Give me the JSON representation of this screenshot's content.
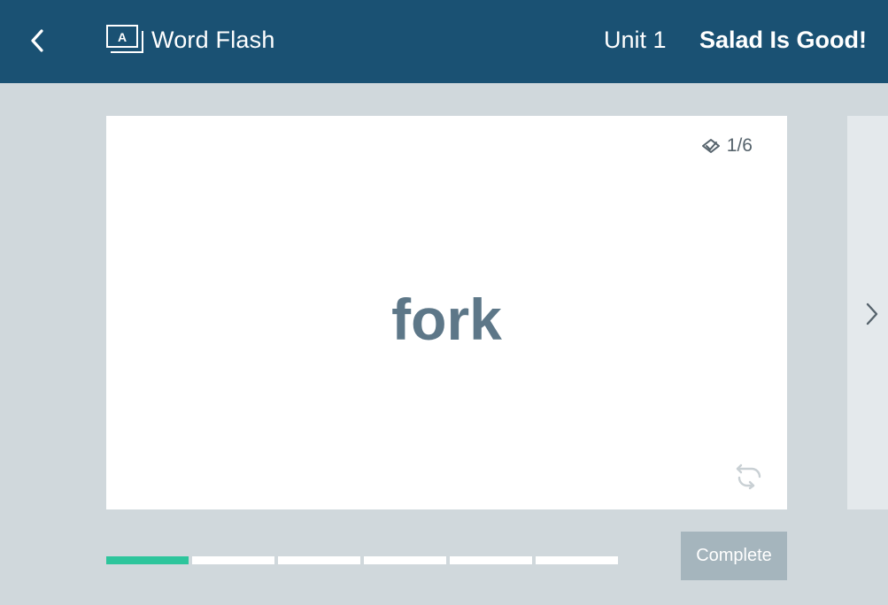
{
  "header": {
    "back_icon": "chevron-left-icon",
    "app_icon": "flashcard-icon",
    "app_icon_letter": "A",
    "app_title": "Word Flash",
    "unit": "Unit 1",
    "lesson_title": "Salad Is Good!"
  },
  "card": {
    "word": "fork",
    "counter_icon": "double-check-icon",
    "counter": "1/6",
    "flip_icon": "flip-arrows-icon"
  },
  "next_icon": "chevron-right-icon",
  "progress": {
    "current": 1,
    "total": 6,
    "done_color": "#2dc59c",
    "todo_color": "#ffffff"
  },
  "complete_label": "Complete",
  "colors": {
    "header_bg": "#1a5173",
    "page_bg": "#d0d8dc",
    "word_color": "#5d7788",
    "button_bg": "#a5b5bd"
  }
}
